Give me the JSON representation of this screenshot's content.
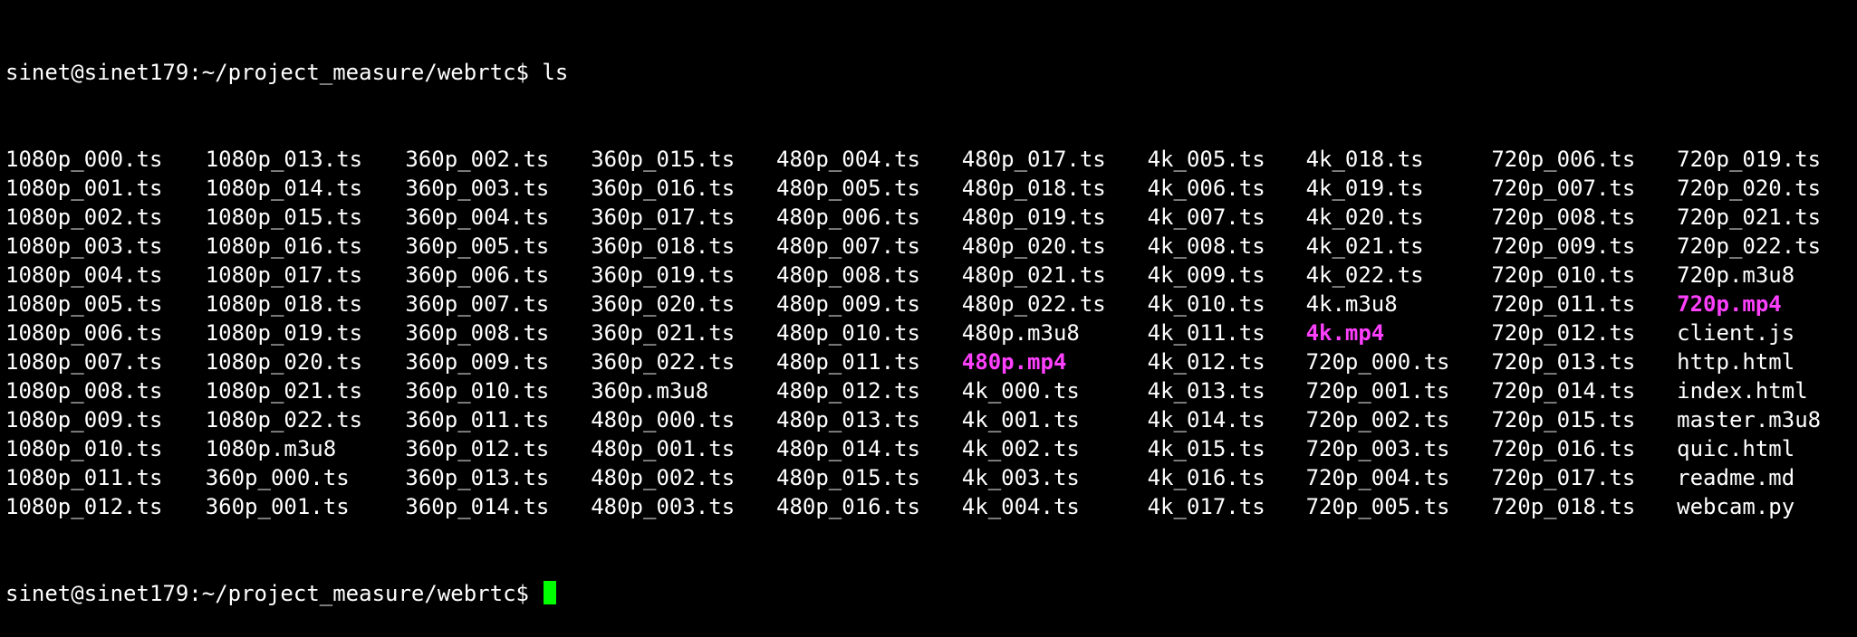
{
  "terminal": {
    "prompt": "sinet@sinet179:~/project_measure/webrtc$",
    "command": "ls",
    "last_prompt": "sinet@sinet179:~/project_measure/webrtc$",
    "colors": {
      "background": "#000000",
      "text": "#ffffff",
      "media_file": "#ff40ff",
      "cursor": "#00ff00"
    }
  },
  "listing": {
    "rows": [
      [
        "1080p_000.ts",
        "1080p_013.ts",
        "360p_002.ts",
        "360p_015.ts",
        "480p_004.ts",
        "480p_017.ts",
        "4k_005.ts",
        "4k_018.ts",
        "720p_006.ts",
        "720p_019.ts"
      ],
      [
        "1080p_001.ts",
        "1080p_014.ts",
        "360p_003.ts",
        "360p_016.ts",
        "480p_005.ts",
        "480p_018.ts",
        "4k_006.ts",
        "4k_019.ts",
        "720p_007.ts",
        "720p_020.ts"
      ],
      [
        "1080p_002.ts",
        "1080p_015.ts",
        "360p_004.ts",
        "360p_017.ts",
        "480p_006.ts",
        "480p_019.ts",
        "4k_007.ts",
        "4k_020.ts",
        "720p_008.ts",
        "720p_021.ts"
      ],
      [
        "1080p_003.ts",
        "1080p_016.ts",
        "360p_005.ts",
        "360p_018.ts",
        "480p_007.ts",
        "480p_020.ts",
        "4k_008.ts",
        "4k_021.ts",
        "720p_009.ts",
        "720p_022.ts"
      ],
      [
        "1080p_004.ts",
        "1080p_017.ts",
        "360p_006.ts",
        "360p_019.ts",
        "480p_008.ts",
        "480p_021.ts",
        "4k_009.ts",
        "4k_022.ts",
        "720p_010.ts",
        "720p.m3u8"
      ],
      [
        "1080p_005.ts",
        "1080p_018.ts",
        "360p_007.ts",
        "360p_020.ts",
        "480p_009.ts",
        "480p_022.ts",
        "4k_010.ts",
        "4k.m3u8",
        "720p_011.ts",
        "720p.mp4"
      ],
      [
        "1080p_006.ts",
        "1080p_019.ts",
        "360p_008.ts",
        "360p_021.ts",
        "480p_010.ts",
        "480p.m3u8",
        "4k_011.ts",
        "4k.mp4",
        "720p_012.ts",
        "client.js"
      ],
      [
        "1080p_007.ts",
        "1080p_020.ts",
        "360p_009.ts",
        "360p_022.ts",
        "480p_011.ts",
        "480p.mp4",
        "4k_012.ts",
        "720p_000.ts",
        "720p_013.ts",
        "http.html"
      ],
      [
        "1080p_008.ts",
        "1080p_021.ts",
        "360p_010.ts",
        "360p.m3u8",
        "480p_012.ts",
        "4k_000.ts",
        "4k_013.ts",
        "720p_001.ts",
        "720p_014.ts",
        "index.html"
      ],
      [
        "1080p_009.ts",
        "1080p_022.ts",
        "360p_011.ts",
        "480p_000.ts",
        "480p_013.ts",
        "4k_001.ts",
        "4k_014.ts",
        "720p_002.ts",
        "720p_015.ts",
        "master.m3u8"
      ],
      [
        "1080p_010.ts",
        "1080p.m3u8",
        "360p_012.ts",
        "480p_001.ts",
        "480p_014.ts",
        "4k_002.ts",
        "4k_015.ts",
        "720p_003.ts",
        "720p_016.ts",
        "quic.html"
      ],
      [
        "1080p_011.ts",
        "360p_000.ts",
        "360p_013.ts",
        "480p_002.ts",
        "480p_015.ts",
        "4k_003.ts",
        "4k_016.ts",
        "720p_004.ts",
        "720p_017.ts",
        "readme.md"
      ],
      [
        "1080p_012.ts",
        "360p_001.ts",
        "360p_014.ts",
        "480p_003.ts",
        "480p_016.ts",
        "4k_004.ts",
        "4k_017.ts",
        "720p_005.ts",
        "720p_018.ts",
        "webcam.py"
      ]
    ],
    "highlighted_files": [
      "720p.mp4",
      "4k.mp4",
      "480p.mp4"
    ]
  }
}
